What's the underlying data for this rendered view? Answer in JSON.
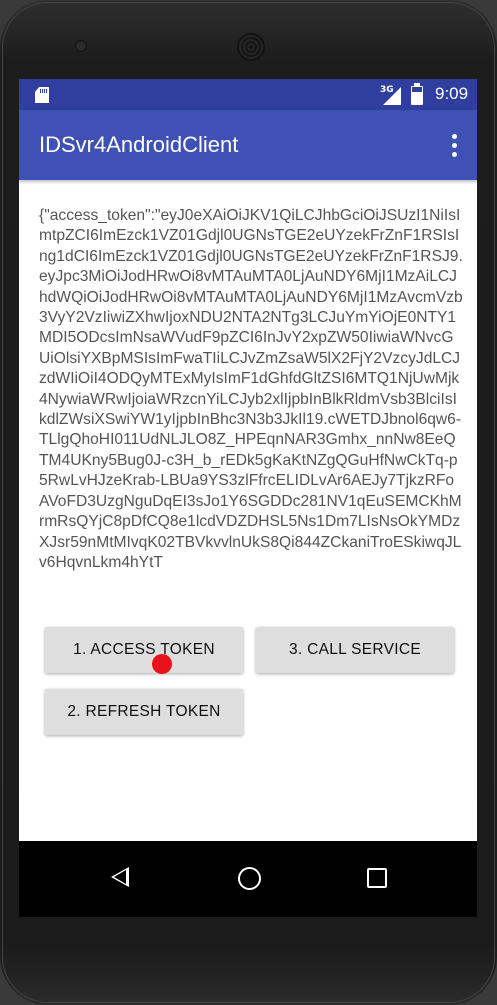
{
  "status_bar": {
    "network": "3G",
    "time": "9:09"
  },
  "app_bar": {
    "title": "IDSvr4AndroidClient",
    "overflow_icon": "more-vert-icon"
  },
  "content": {
    "token_text": "{\"access_token\":\"eyJ0eXAiOiJKV1QiLCJhbGciOiJSUzI1NiIsImtpZCI6ImEzck1VZ01Gdjl0UGNsTGE2eUYzekFrZnF1RSIsIng1dCI6ImEzck1VZ01Gdjl0UGNsTGE2eUYzekFrZnF1RSJ9.eyJpc3MiOiJodHRwOi8vMTAuMTA0LjAuNDY6MjI1MzAiLCJhdWQiOiJodHRwOi8vMTAuMTA0LjAuNDY6MjI1MzAvcmVzb3VyY2VzIiwiZXhwIjoxNDU2NTA2NTg3LCJuYmYiOjE0NTY1MDI5ODcsImNsaWVudF9pZCI6InJvY2xpZW50IiwiaWNvcGUiOlsiYXBpMSIsImFwaTIiLCJvZmZsaW5lX2FjY2VzcyJdLCJzdWIiOiI4ODQyMTExMyIsImF1dGhfdGltZSI6MTQ1NjUwMjk4NywiaWRwIjoiaWRzcnYiLCJyb2xlIjpbInBlkRldmVsb3BlciIsIkdlZWsiXSwiYW1yIjpbInBhc3N3b3JkIl19.cWETDJbnol6qw6-TLlgQhoHI011UdNLJLO8Z_HPEqnNAR3Gmhx_nnNw8EeQTM4UKny5Bug0J-c3H_b_rEDk5gKaKtNZgQGuHfNwCkTq-p5RwLvHJzeKrab-LBUa9YS3zlFfrcELIDLvAr6AEJy7TjkzRFoAVoFD3UzgNguDqEI3sJo1Y6SGDDc281NV1qEuSEMCKhMrmRsQYjC8pDfCQ8e1lcdVDZDHSL5Ns1Dm7LIsNsOkYMDzXJsr59nMtMIvqK02TBVkvvlnUkS8Qi844ZCkaniTroESkiwqJLv6HqvnLkm4hYtT"
  },
  "buttons": {
    "access_token": "1. ACCESS TOKEN",
    "call_service": "3. CALL SERVICE",
    "refresh_token": "2. REFRESH TOKEN"
  },
  "colors": {
    "primary": "#3f51b5",
    "primary_dark": "#303f9f",
    "touch_indicator": "#e8111c"
  }
}
